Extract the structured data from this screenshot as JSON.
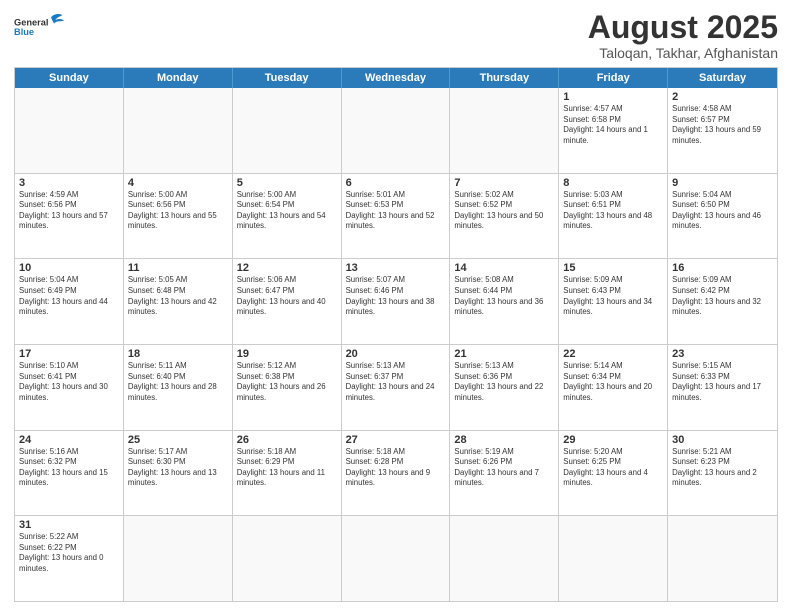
{
  "header": {
    "logo_general": "General",
    "logo_blue": "Blue",
    "main_title": "August 2025",
    "sub_title": "Taloqan, Takhar, Afghanistan"
  },
  "days_of_week": [
    "Sunday",
    "Monday",
    "Tuesday",
    "Wednesday",
    "Thursday",
    "Friday",
    "Saturday"
  ],
  "weeks": [
    [
      {
        "day": "",
        "info": "",
        "empty": true
      },
      {
        "day": "",
        "info": "",
        "empty": true
      },
      {
        "day": "",
        "info": "",
        "empty": true
      },
      {
        "day": "",
        "info": "",
        "empty": true
      },
      {
        "day": "",
        "info": "",
        "empty": true
      },
      {
        "day": "1",
        "info": "Sunrise: 4:57 AM\nSunset: 6:58 PM\nDaylight: 14 hours and 1 minute.",
        "empty": false
      },
      {
        "day": "2",
        "info": "Sunrise: 4:58 AM\nSunset: 6:57 PM\nDaylight: 13 hours and 59 minutes.",
        "empty": false
      }
    ],
    [
      {
        "day": "3",
        "info": "Sunrise: 4:59 AM\nSunset: 6:56 PM\nDaylight: 13 hours and 57 minutes.",
        "empty": false
      },
      {
        "day": "4",
        "info": "Sunrise: 5:00 AM\nSunset: 6:56 PM\nDaylight: 13 hours and 55 minutes.",
        "empty": false
      },
      {
        "day": "5",
        "info": "Sunrise: 5:00 AM\nSunset: 6:54 PM\nDaylight: 13 hours and 54 minutes.",
        "empty": false
      },
      {
        "day": "6",
        "info": "Sunrise: 5:01 AM\nSunset: 6:53 PM\nDaylight: 13 hours and 52 minutes.",
        "empty": false
      },
      {
        "day": "7",
        "info": "Sunrise: 5:02 AM\nSunset: 6:52 PM\nDaylight: 13 hours and 50 minutes.",
        "empty": false
      },
      {
        "day": "8",
        "info": "Sunrise: 5:03 AM\nSunset: 6:51 PM\nDaylight: 13 hours and 48 minutes.",
        "empty": false
      },
      {
        "day": "9",
        "info": "Sunrise: 5:04 AM\nSunset: 6:50 PM\nDaylight: 13 hours and 46 minutes.",
        "empty": false
      }
    ],
    [
      {
        "day": "10",
        "info": "Sunrise: 5:04 AM\nSunset: 6:49 PM\nDaylight: 13 hours and 44 minutes.",
        "empty": false
      },
      {
        "day": "11",
        "info": "Sunrise: 5:05 AM\nSunset: 6:48 PM\nDaylight: 13 hours and 42 minutes.",
        "empty": false
      },
      {
        "day": "12",
        "info": "Sunrise: 5:06 AM\nSunset: 6:47 PM\nDaylight: 13 hours and 40 minutes.",
        "empty": false
      },
      {
        "day": "13",
        "info": "Sunrise: 5:07 AM\nSunset: 6:46 PM\nDaylight: 13 hours and 38 minutes.",
        "empty": false
      },
      {
        "day": "14",
        "info": "Sunrise: 5:08 AM\nSunset: 6:44 PM\nDaylight: 13 hours and 36 minutes.",
        "empty": false
      },
      {
        "day": "15",
        "info": "Sunrise: 5:09 AM\nSunset: 6:43 PM\nDaylight: 13 hours and 34 minutes.",
        "empty": false
      },
      {
        "day": "16",
        "info": "Sunrise: 5:09 AM\nSunset: 6:42 PM\nDaylight: 13 hours and 32 minutes.",
        "empty": false
      }
    ],
    [
      {
        "day": "17",
        "info": "Sunrise: 5:10 AM\nSunset: 6:41 PM\nDaylight: 13 hours and 30 minutes.",
        "empty": false
      },
      {
        "day": "18",
        "info": "Sunrise: 5:11 AM\nSunset: 6:40 PM\nDaylight: 13 hours and 28 minutes.",
        "empty": false
      },
      {
        "day": "19",
        "info": "Sunrise: 5:12 AM\nSunset: 6:38 PM\nDaylight: 13 hours and 26 minutes.",
        "empty": false
      },
      {
        "day": "20",
        "info": "Sunrise: 5:13 AM\nSunset: 6:37 PM\nDaylight: 13 hours and 24 minutes.",
        "empty": false
      },
      {
        "day": "21",
        "info": "Sunrise: 5:13 AM\nSunset: 6:36 PM\nDaylight: 13 hours and 22 minutes.",
        "empty": false
      },
      {
        "day": "22",
        "info": "Sunrise: 5:14 AM\nSunset: 6:34 PM\nDaylight: 13 hours and 20 minutes.",
        "empty": false
      },
      {
        "day": "23",
        "info": "Sunrise: 5:15 AM\nSunset: 6:33 PM\nDaylight: 13 hours and 17 minutes.",
        "empty": false
      }
    ],
    [
      {
        "day": "24",
        "info": "Sunrise: 5:16 AM\nSunset: 6:32 PM\nDaylight: 13 hours and 15 minutes.",
        "empty": false
      },
      {
        "day": "25",
        "info": "Sunrise: 5:17 AM\nSunset: 6:30 PM\nDaylight: 13 hours and 13 minutes.",
        "empty": false
      },
      {
        "day": "26",
        "info": "Sunrise: 5:18 AM\nSunset: 6:29 PM\nDaylight: 13 hours and 11 minutes.",
        "empty": false
      },
      {
        "day": "27",
        "info": "Sunrise: 5:18 AM\nSunset: 6:28 PM\nDaylight: 13 hours and 9 minutes.",
        "empty": false
      },
      {
        "day": "28",
        "info": "Sunrise: 5:19 AM\nSunset: 6:26 PM\nDaylight: 13 hours and 7 minutes.",
        "empty": false
      },
      {
        "day": "29",
        "info": "Sunrise: 5:20 AM\nSunset: 6:25 PM\nDaylight: 13 hours and 4 minutes.",
        "empty": false
      },
      {
        "day": "30",
        "info": "Sunrise: 5:21 AM\nSunset: 6:23 PM\nDaylight: 13 hours and 2 minutes.",
        "empty": false
      }
    ],
    [
      {
        "day": "31",
        "info": "Sunrise: 5:22 AM\nSunset: 6:22 PM\nDaylight: 13 hours and 0 minutes.",
        "empty": false
      },
      {
        "day": "",
        "info": "",
        "empty": true
      },
      {
        "day": "",
        "info": "",
        "empty": true
      },
      {
        "day": "",
        "info": "",
        "empty": true
      },
      {
        "day": "",
        "info": "",
        "empty": true
      },
      {
        "day": "",
        "info": "",
        "empty": true
      },
      {
        "day": "",
        "info": "",
        "empty": true
      }
    ]
  ]
}
